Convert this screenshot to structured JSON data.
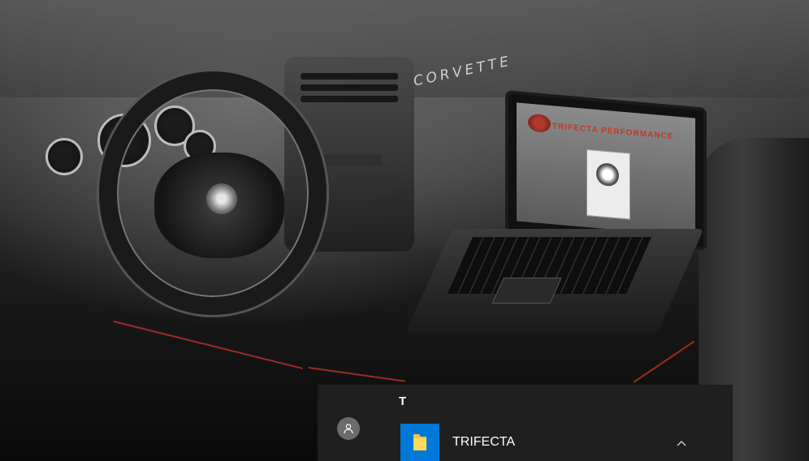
{
  "start_menu": {
    "section_letter": "T",
    "app": {
      "label": "TRIFECTA",
      "icon": "folder-icon",
      "tile_color": "#0078d7"
    },
    "expand_icon": "chevron-up-icon",
    "user_icon": "user-icon"
  },
  "wallpaper": {
    "dashboard_text": "CORVETTE",
    "laptop_screen_text": "TRIFECTA PERFORMANCE"
  },
  "colors": {
    "panel_bg": "#1f1f1f",
    "accent": "#0078d7",
    "brand_red": "#c0392b"
  }
}
